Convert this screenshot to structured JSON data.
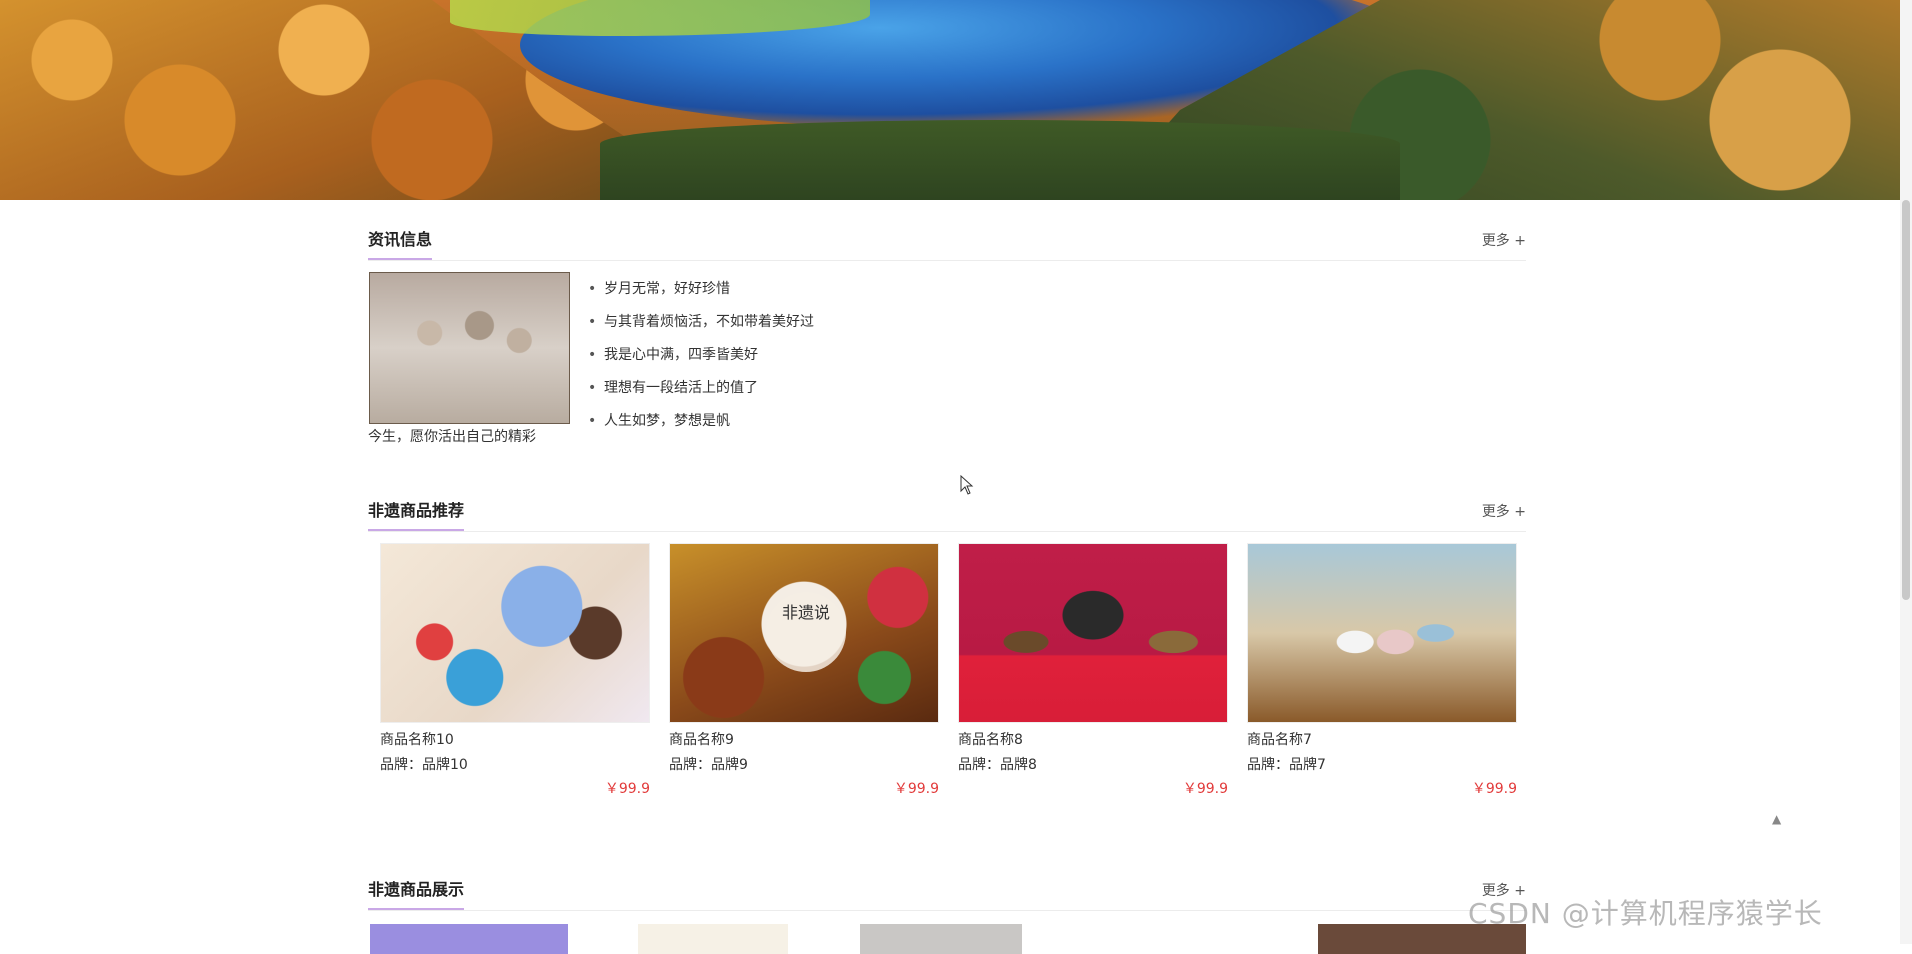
{
  "news": {
    "title": "资讯信息",
    "more": "更多 +",
    "items": [
      "岁月无常，好好珍惜",
      "与其背着烦恼活，不如带着美好过",
      "我是心中满，四季皆美好",
      "理想有一段结活上的值了",
      "人生如梦，梦想是帆"
    ],
    "caption": "今生，愿你活出自己的精彩"
  },
  "recommend": {
    "title": "非遗商品推荐",
    "more": "更多 +",
    "seal_text": "非遗说",
    "products": [
      {
        "name": "商品名称10",
        "brand": "品牌：品牌10",
        "price": "￥99.9"
      },
      {
        "name": "商品名称9",
        "brand": "品牌：品牌9",
        "price": "￥99.9"
      },
      {
        "name": "商品名称8",
        "brand": "品牌：品牌8",
        "price": "￥99.9"
      },
      {
        "name": "商品名称7",
        "brand": "品牌：品牌7",
        "price": "￥99.9"
      }
    ]
  },
  "showcase": {
    "title": "非遗商品展示",
    "more": "更多 +"
  },
  "back_top": "▲",
  "watermark": "CSDN @计算机程序猿学长"
}
